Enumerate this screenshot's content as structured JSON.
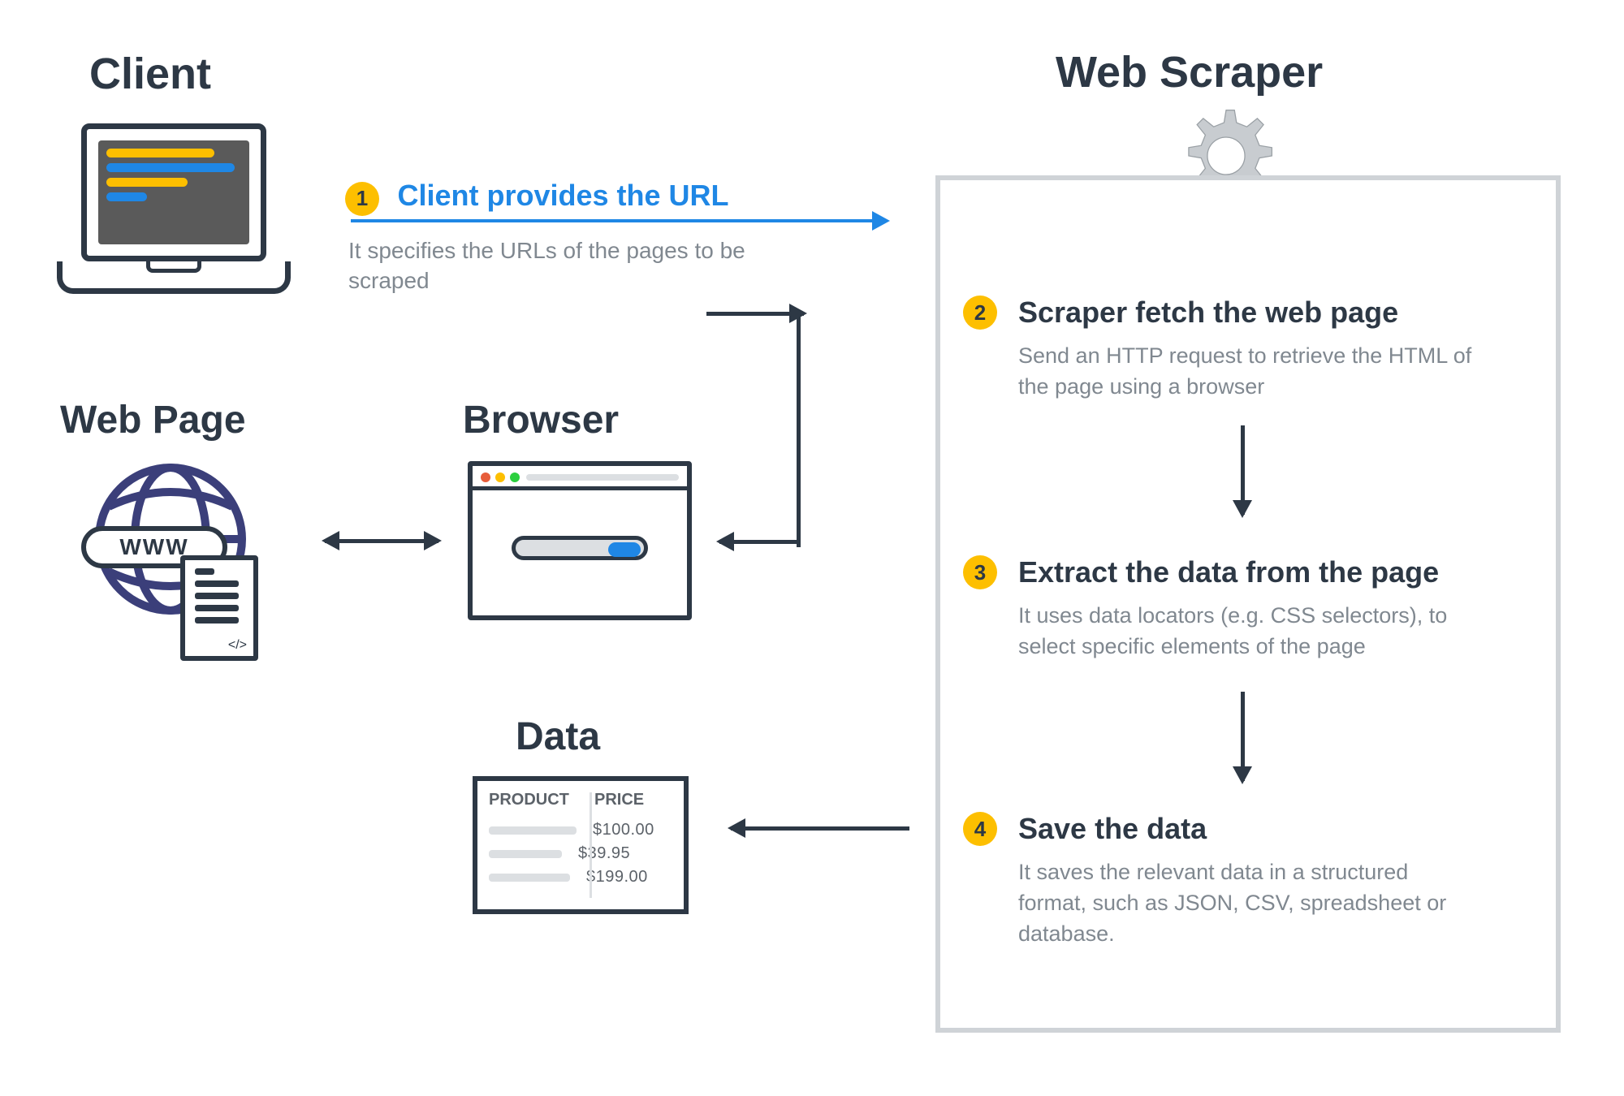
{
  "titles": {
    "client": "Client",
    "web_scraper": "Web Scraper",
    "web_page": "Web Page",
    "browser": "Browser",
    "data": "Data"
  },
  "globe": {
    "www": "WWW",
    "doc_tag": "</>"
  },
  "data_table": {
    "headers": {
      "product": "PRODUCT",
      "price": "PRICE"
    },
    "prices": [
      "$100.00",
      "$39.95",
      "$199.00"
    ]
  },
  "steps": [
    {
      "num": "1",
      "title": "Client provides the URL",
      "desc": "It specifies the URLs of the pages to be scraped"
    },
    {
      "num": "2",
      "title": "Scraper fetch the web page",
      "desc": "Send an HTTP request to retrieve the HTML of the page using a browser"
    },
    {
      "num": "3",
      "title": "Extract the data from the page",
      "desc": "It uses data locators (e.g. CSS selectors), to select specific elements of the page"
    },
    {
      "num": "4",
      "title": "Save the data",
      "desc": "It saves the relevant data in a structured format, such as JSON, CSV, spreadsheet or database."
    }
  ],
  "colors": {
    "accent_yellow": "#fdbf00",
    "accent_blue": "#1f87e5",
    "ink": "#2d3845",
    "muted": "#808890"
  }
}
